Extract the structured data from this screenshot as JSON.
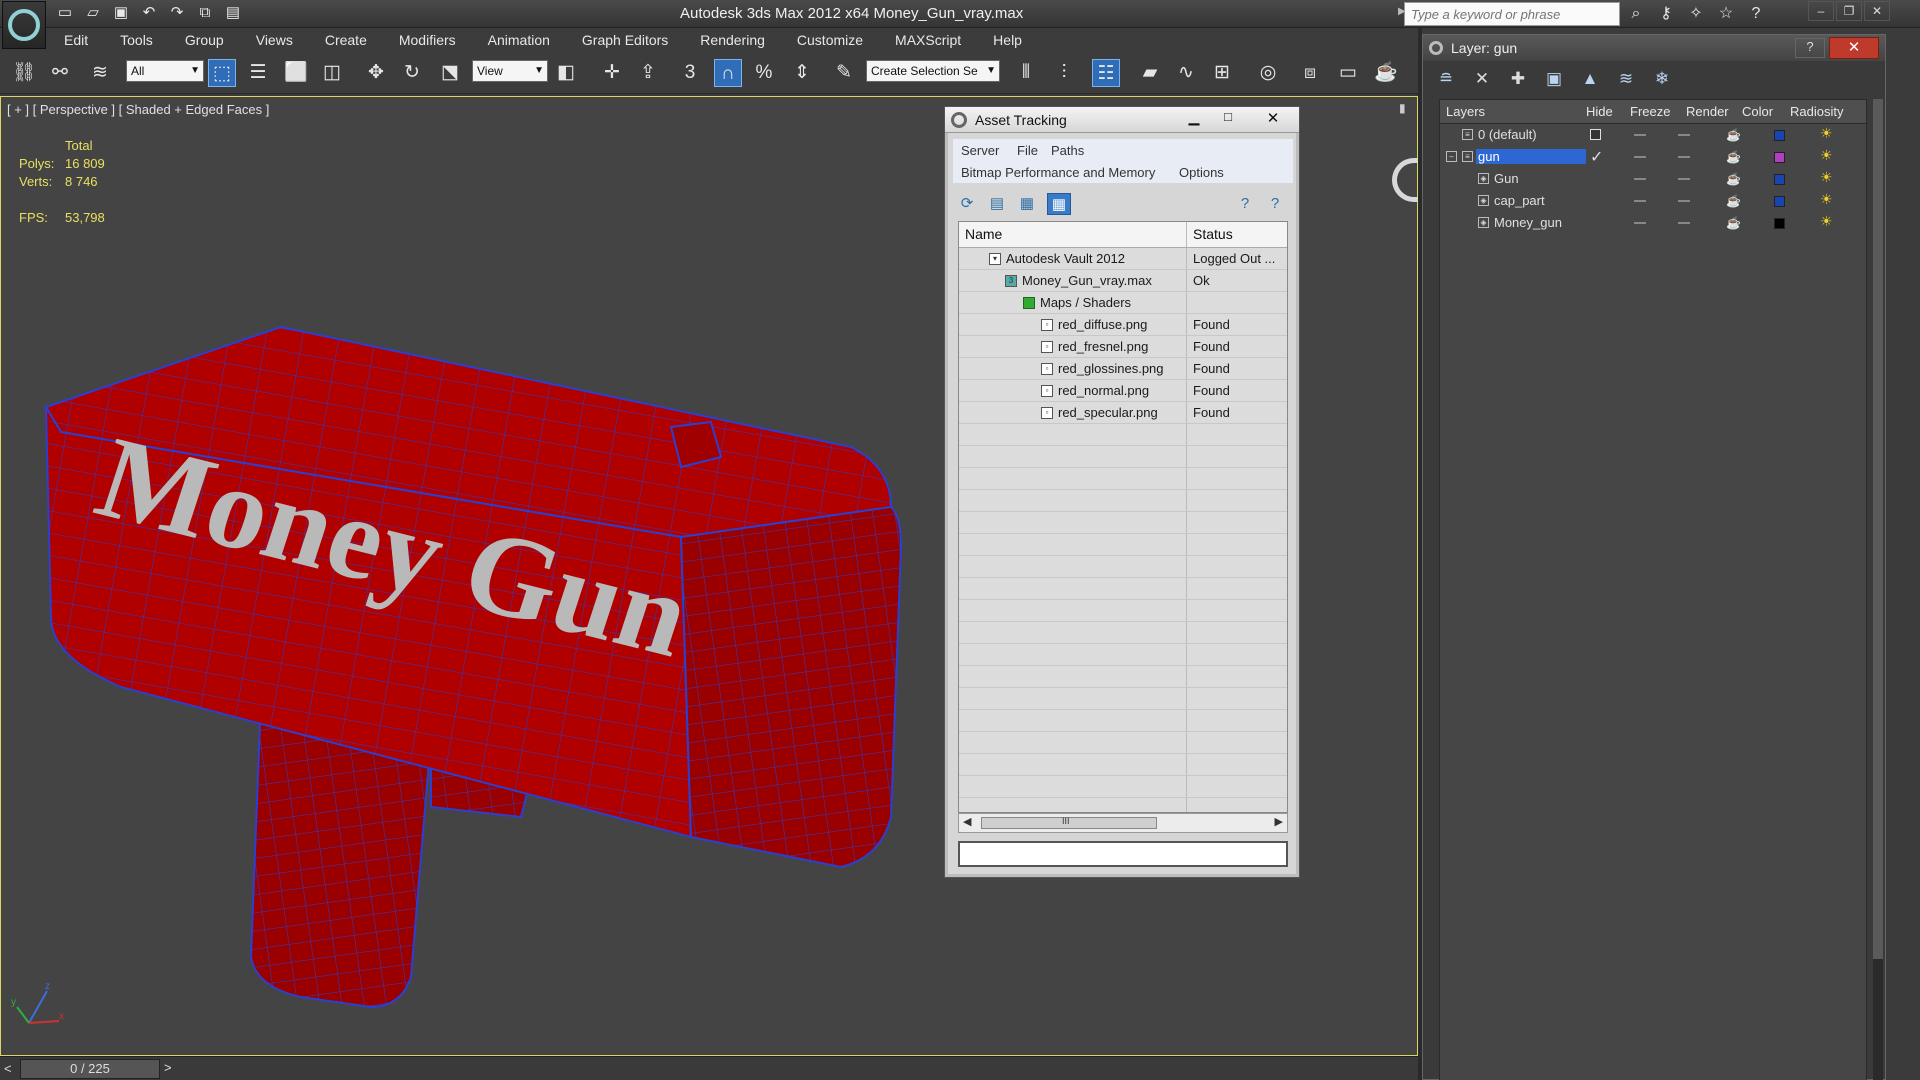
{
  "app": {
    "title": "Autodesk 3ds Max  2012 x64      Money_Gun_vray.max",
    "search_placeholder": "Type a keyword or phrase"
  },
  "menus": [
    "Edit",
    "Tools",
    "Group",
    "Views",
    "Create",
    "Modifiers",
    "Animation",
    "Graph Editors",
    "Rendering",
    "Customize",
    "MAXScript",
    "Help"
  ],
  "toolbar": {
    "selection_filter": "All",
    "ref_coord": "View",
    "named_selection": "Create Selection Se",
    "snap_label": "3",
    "percent_snap": "%"
  },
  "viewport": {
    "label": "[ + ] [ Perspective ] [ Shaded + Edged Faces ]",
    "stats_header": "Total",
    "polys_label": "Polys:",
    "polys_value": "16 809",
    "verts_label": "Verts:",
    "verts_value": "8 746",
    "fps_label": "FPS:",
    "fps_value": "53,798",
    "model_text": "Money Gun",
    "axis_z": "z",
    "axis_x": "x",
    "axis_y": "y"
  },
  "timeline": {
    "frame": "0 / 225",
    "prev": "<",
    "next": ">"
  },
  "asset_tracking": {
    "title": "Asset Tracking",
    "menu": [
      "Server",
      "File",
      "Paths"
    ],
    "menu2": [
      "Bitmap Performance and Memory",
      "Options"
    ],
    "columns": [
      "Name",
      "Status"
    ],
    "rows": [
      {
        "name": "Autodesk Vault 2012",
        "status": "Logged Out ..."
      },
      {
        "name": "Money_Gun_vray.max",
        "status": "Ok"
      },
      {
        "name": "Maps / Shaders",
        "status": ""
      },
      {
        "name": "red_diffuse.png",
        "status": "Found"
      },
      {
        "name": "red_fresnel.png",
        "status": "Found"
      },
      {
        "name": "red_glossines.png",
        "status": "Found"
      },
      {
        "name": "red_normal.png",
        "status": "Found"
      },
      {
        "name": "red_specular.png",
        "status": "Found"
      }
    ],
    "scroll_grip": "III",
    "path_value": ""
  },
  "layer_window": {
    "title": "Layer: gun",
    "help": "?",
    "close": "✕",
    "columns": [
      "Layers",
      "Hide",
      "Freeze",
      "Render",
      "Color",
      "Radiosity"
    ],
    "rows": [
      {
        "name": "0 (default)",
        "color": "#1a44b0"
      },
      {
        "name": "gun",
        "color": "#b040c0"
      },
      {
        "name": "Gun",
        "color": "#1a44b0"
      },
      {
        "name": "cap_part",
        "color": "#1a44b0"
      },
      {
        "name": "Money_gun",
        "color": "#000000"
      }
    ]
  },
  "icons": {
    "quick_access": [
      "new-icon",
      "open-icon",
      "save-icon",
      "undo-icon",
      "redo-icon",
      "project-icon",
      "window-icon"
    ],
    "layer_toolbar": [
      "create-layer-icon",
      "delete-layer-icon",
      "add-to-layer-icon",
      "select-layer-icon",
      "highlight-layer-icon",
      "hide-all-icon",
      "freeze-all-icon"
    ]
  },
  "colors": {
    "model_red": "#b00000",
    "wire_blue": "#2b3fd0",
    "stats_yellow": "#e8e060",
    "selection_blue": "#2d67d4"
  }
}
